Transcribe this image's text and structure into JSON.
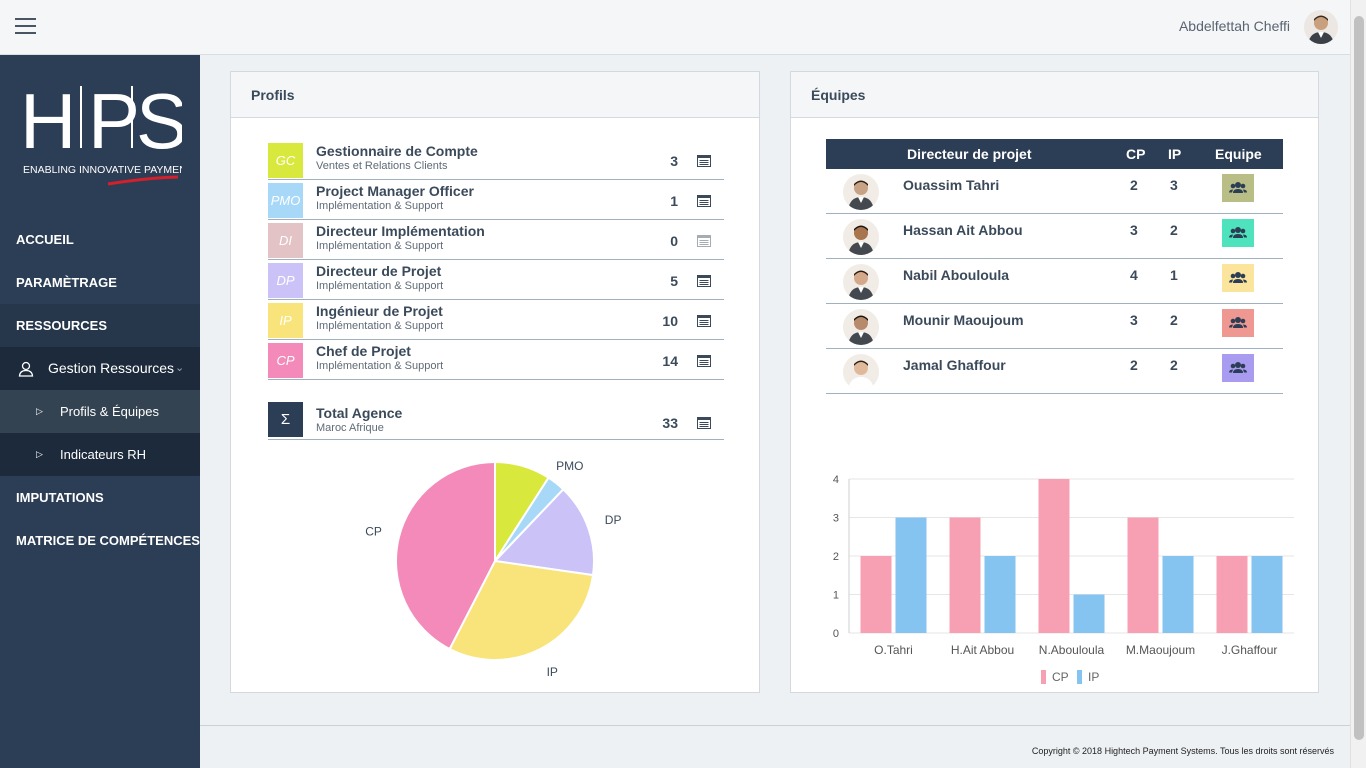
{
  "header": {
    "user_name": "Abdelfettah Cheffi"
  },
  "logo": {
    "letters": "HPS",
    "tagline": "ENABLING INNOVATIVE PAYMENTS"
  },
  "sidebar": {
    "items": [
      {
        "label": "ACCUEIL"
      },
      {
        "label": "PARAMÈTRAGE"
      },
      {
        "label": "RESSOURCES"
      },
      {
        "label": "Gestion Ressources"
      },
      {
        "label": "Profils & Équipes"
      },
      {
        "label": "Indicateurs RH"
      },
      {
        "label": "IMPUTATIONS"
      },
      {
        "label": "MATRICE DE COMPÉTENCES"
      }
    ]
  },
  "profils": {
    "title": "Profils",
    "rows": [
      {
        "code": "GC",
        "name": "Gestionnaire de Compte",
        "sub": "Ventes et Relations Clients",
        "count": "3",
        "color": "#d9e83c"
      },
      {
        "code": "PMO",
        "name": "Project Manager Officer",
        "sub": "Implémentation & Support",
        "count": "1",
        "color": "#a8d8f8"
      },
      {
        "code": "DI",
        "name": "Directeur Implémentation",
        "sub": "Implémentation & Support",
        "count": "0",
        "color": "#e3c3c6"
      },
      {
        "code": "DP",
        "name": "Directeur de Projet",
        "sub": "Implémentation & Support",
        "count": "5",
        "color": "#cbc3f7"
      },
      {
        "code": "IP",
        "name": "Ingénieur de Projet",
        "sub": "Implémentation & Support",
        "count": "10",
        "color": "#f8e47a"
      },
      {
        "code": "CP",
        "name": "Chef de Projet",
        "sub": "Implémentation & Support",
        "count": "14",
        "color": "#f38ab9"
      }
    ],
    "total": {
      "symbol": "Σ",
      "name": "Total Agence",
      "sub": "Maroc Afrique",
      "count": "33"
    }
  },
  "equipes": {
    "title": "Équipes",
    "columns": [
      "Directeur de projet",
      "CP",
      "IP",
      "Equipe"
    ],
    "rows": [
      {
        "name": "Ouassim Tahri",
        "cp": "2",
        "ip": "3",
        "color": "#b9be86"
      },
      {
        "name": "Hassan Ait Abbou",
        "cp": "3",
        "ip": "2",
        "color": "#4ee3bd"
      },
      {
        "name": "Nabil Abouloula",
        "cp": "4",
        "ip": "1",
        "color": "#fbe49b"
      },
      {
        "name": "Mounir Maoujoum",
        "cp": "3",
        "ip": "2",
        "color": "#ef9791"
      },
      {
        "name": "Jamal Ghaffour",
        "cp": "2",
        "ip": "2",
        "color": "#a99cf0"
      }
    ]
  },
  "footer": {
    "text": "Copyright © 2018 Hightech Payment Systems. Tous les droits sont réservés"
  },
  "chart_data": [
    {
      "type": "pie",
      "categories": [
        "GC",
        "PMO",
        "DI",
        "DP",
        "IP",
        "CP"
      ],
      "values": [
        3,
        1,
        0,
        5,
        10,
        14
      ],
      "colors": [
        "#d9e83c",
        "#a8d8f8",
        "#e3c3c6",
        "#cbc3f7",
        "#f8e47a",
        "#f38ab9"
      ]
    },
    {
      "type": "bar",
      "categories": [
        "O.Tahri",
        "H.Ait Abbou",
        "N.Abouloula",
        "M.Maoujoum",
        "J.Ghaffour"
      ],
      "series": [
        {
          "name": "CP",
          "values": [
            2,
            3,
            4,
            3,
            2
          ],
          "color": "#f8a0b3"
        },
        {
          "name": "IP",
          "values": [
            3,
            2,
            1,
            2,
            2
          ],
          "color": "#85c3f0"
        }
      ],
      "ylim": [
        0,
        4
      ],
      "yticks": [
        "0",
        "1",
        "2",
        "3",
        "4"
      ],
      "grid": true,
      "legend": "bottom"
    }
  ]
}
